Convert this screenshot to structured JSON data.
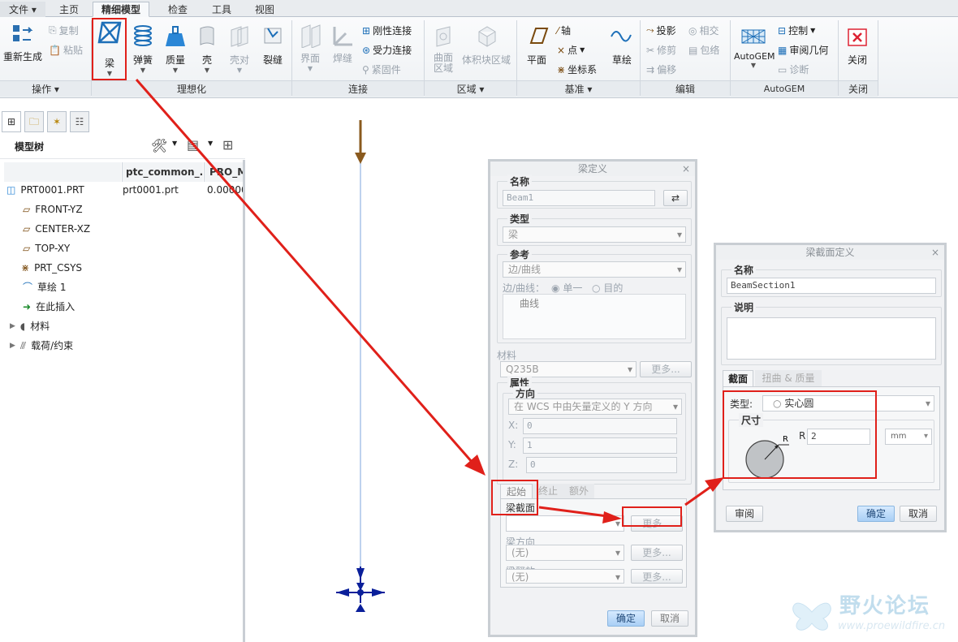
{
  "menu_tabs": [
    "文件",
    "主页",
    "精细模型",
    "检查",
    "工具",
    "视图"
  ],
  "ribbon": {
    "ops": {
      "regen": "重新生成",
      "copy": "复制",
      "paste": "粘贴",
      "group": "操作"
    },
    "ideal": {
      "beam": "梁",
      "spring": "弹簧",
      "mass": "质量",
      "shell": "壳",
      "shellpair": "壳对",
      "crack": "裂缝",
      "group": "理想化"
    },
    "conn": {
      "interface": "界面",
      "weld": "焊缝",
      "rigid": "刚性连接",
      "weighted": "受力连接",
      "fastener": "紧固件",
      "group": "连接"
    },
    "region": {
      "surface": "曲面区域",
      "volume": "体积块区域",
      "group": "区域"
    },
    "datum": {
      "plane": "平面",
      "axis": "轴",
      "point": "点",
      "csys": "坐标系",
      "sketch": "草绘",
      "group": "基准"
    },
    "edit": {
      "project": "投影",
      "trim": "修剪",
      "offset": "偏移",
      "intersect": "相交",
      "wrap": "包络",
      "group": "编辑"
    },
    "autogem": {
      "label": "AutoGEM",
      "control": "控制",
      "review": "审阅几何",
      "diagnose": "诊断",
      "group": "AutoGEM"
    },
    "close": {
      "label": "关闭",
      "group": "关闭"
    }
  },
  "tree": {
    "title": "模型树",
    "columns": [
      "ptc_common_...",
      "PRO_M"
    ],
    "items": [
      {
        "name": "PRT0001.PRT",
        "col1": "prt0001.prt",
        "col2": "0.00000"
      },
      {
        "name": "FRONT-YZ"
      },
      {
        "name": "CENTER-XZ"
      },
      {
        "name": "TOP-XY"
      },
      {
        "name": "PRT_CSYS"
      },
      {
        "name": "草绘 1"
      },
      {
        "name": "在此插入"
      },
      {
        "name": "材料"
      },
      {
        "name": "载荷/约束"
      }
    ]
  },
  "beam_dialog": {
    "title": "梁定义",
    "name_legend": "名称",
    "name_value": "Beam1",
    "type_legend": "类型",
    "type_value": "梁",
    "ref_legend": "参考",
    "ref_value": "边/曲线",
    "edge_label": "边/曲线：",
    "radio_single": "单一",
    "radio_target": "目的",
    "ref_list": "曲线",
    "material_label": "材料",
    "material_value": "Q235B",
    "more": "更多...",
    "props_legend": "属性",
    "dir_legend": "方向",
    "dir_value": "在 WCS 中由矢量定义的 Y 方向",
    "x_label": "X:",
    "x_value": "0",
    "y_label": "Y:",
    "y_value": "1",
    "z_label": "Z:",
    "z_value": "0",
    "tabs": [
      "起始",
      "终止",
      "额外"
    ],
    "section_label": "梁截面",
    "orient_label": "梁方向",
    "orient_value": "(无)",
    "release_label": "梁释放",
    "release_value": "(无)",
    "ok": "确定",
    "cancel": "取消"
  },
  "section_dialog": {
    "title": "梁截面定义",
    "name_legend": "名称",
    "name_value": "BeamSection1",
    "desc_legend": "说明",
    "tabs": [
      "截面",
      "扭曲 & 质量"
    ],
    "type_label": "类型:",
    "type_value": "实心圆",
    "dims_legend": "尺寸",
    "r_label": "R",
    "r_value": "2",
    "unit": "mm",
    "review": "审阅",
    "ok": "确定",
    "cancel": "取消"
  },
  "watermark": {
    "name": "野火论坛",
    "url": "www.proewildfire.cn"
  },
  "colors": {
    "accent_red": "#e0201a",
    "csys_blue": "#0a1f9a",
    "axis_brown": "#8a5a1e"
  }
}
